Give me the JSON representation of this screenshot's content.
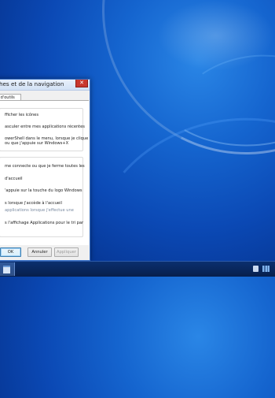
{
  "dialog": {
    "title": "ches et de la navigation",
    "close_glyph": "✕",
    "tab_label": "e d'outils",
    "options": [
      "fficher les icônes",
      "asculer entre mes applications récentes",
      "owerShell dans le menu, lorsque je clique",
      "ou que j'appuie sur Windows+X",
      "me connecte ou que je ferme toutes les",
      "d'accueil",
      "'appuie sur la touche du logo Windows",
      "s lorsque j'accède à l'accueil",
      "applications lorsque j'effectue une",
      "s l'affichage Applications pour le tri par"
    ],
    "buttons": {
      "ok": "OK",
      "cancel": "Annuler",
      "apply": "Appliquer"
    }
  },
  "taskbar": {
    "app_icon": "file-explorer-icon",
    "tray_icons": [
      "flag-icon",
      "network-icon"
    ]
  },
  "colors": {
    "desktop_blue": "#0b49b5",
    "close_red": "#c8372d",
    "taskbar": "#071f4c"
  }
}
